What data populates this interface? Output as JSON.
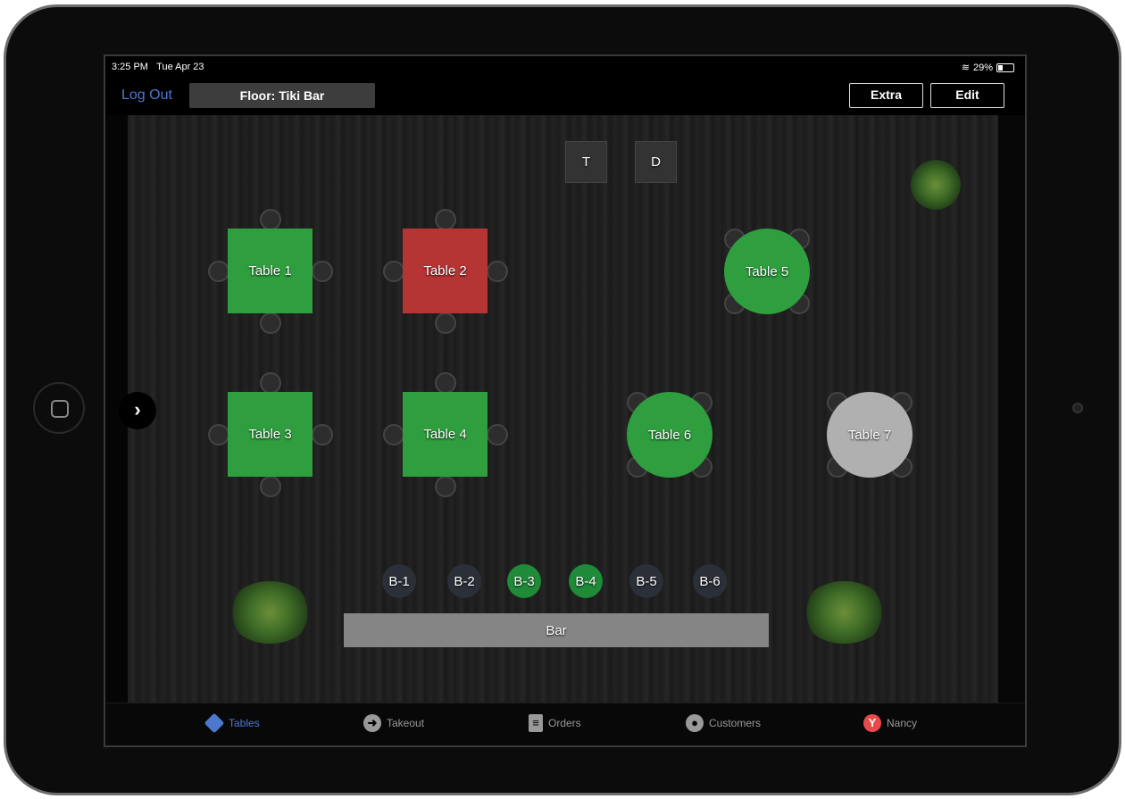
{
  "status": {
    "time": "3:25 PM",
    "date": "Tue Apr 23",
    "battery": "29%",
    "battery_level": 0.29
  },
  "toolbar": {
    "logout": "Log Out",
    "floor": "Floor: Tiki Bar",
    "extra": "Extra",
    "edit": "Edit"
  },
  "colors": {
    "available": "#2e9e3e",
    "occupied": "#b53434",
    "inactive": "#b0b0b0",
    "bar_seat": "#2b2f38",
    "bar_seat_active": "#1f8a38",
    "accent": "#4d78d0",
    "nancy": "#e84a4a"
  },
  "stations": [
    {
      "label": "T"
    },
    {
      "label": "D"
    }
  ],
  "tables": [
    {
      "label": "Table 1",
      "shape": "square",
      "status": "available"
    },
    {
      "label": "Table 2",
      "shape": "square",
      "status": "occupied"
    },
    {
      "label": "Table 3",
      "shape": "square",
      "status": "available"
    },
    {
      "label": "Table 4",
      "shape": "square",
      "status": "available"
    },
    {
      "label": "Table 5",
      "shape": "round",
      "status": "available"
    },
    {
      "label": "Table 6",
      "shape": "round",
      "status": "available"
    },
    {
      "label": "Table 7",
      "shape": "round",
      "status": "inactive"
    }
  ],
  "bar_seats": [
    {
      "label": "B-1",
      "status": "empty"
    },
    {
      "label": "B-2",
      "status": "empty"
    },
    {
      "label": "B-3",
      "status": "active"
    },
    {
      "label": "B-4",
      "status": "active"
    },
    {
      "label": "B-5",
      "status": "empty"
    },
    {
      "label": "B-6",
      "status": "empty"
    }
  ],
  "bar": {
    "label": "Bar"
  },
  "tabs": [
    {
      "label": "Tables",
      "icon": "tables-icon",
      "active": true
    },
    {
      "label": "Takeout",
      "icon": "arrow-right-circle-icon"
    },
    {
      "label": "Orders",
      "icon": "clipboard-icon"
    },
    {
      "label": "Customers",
      "icon": "person-icon"
    },
    {
      "label": "Nancy",
      "icon": "user-avatar-icon"
    }
  ]
}
